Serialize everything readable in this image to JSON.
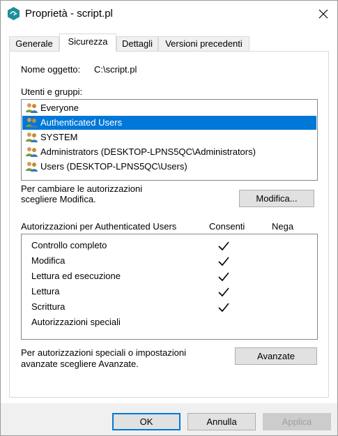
{
  "window": {
    "title": "Proprietà - script.pl"
  },
  "tabs": [
    {
      "label": "Generale"
    },
    {
      "label": "Sicurezza"
    },
    {
      "label": "Dettagli"
    },
    {
      "label": "Versioni precedenti"
    }
  ],
  "active_tab": "Sicurezza",
  "object": {
    "label": "Nome oggetto:",
    "value": "C:\\script.pl"
  },
  "users_label": "Utenti e gruppi:",
  "users": [
    {
      "name": "Everyone",
      "selected": false
    },
    {
      "name": "Authenticated Users",
      "selected": true
    },
    {
      "name": "SYSTEM",
      "selected": false
    },
    {
      "name": "Administrators (DESKTOP-LPNS5QC\\Administrators)",
      "selected": false
    },
    {
      "name": "Users (DESKTOP-LPNS5QC\\Users)",
      "selected": false
    }
  ],
  "change_hint": {
    "line1": "Per cambiare le autorizzazioni",
    "line2": "scegliere Modifica."
  },
  "edit_button": "Modifica...",
  "permissions": {
    "header": "Autorizzazioni per Authenticated Users",
    "allow_col": "Consenti",
    "deny_col": "Nega",
    "items": [
      {
        "name": "Controllo completo",
        "allow": true,
        "deny": false
      },
      {
        "name": "Modifica",
        "allow": true,
        "deny": false
      },
      {
        "name": "Lettura ed esecuzione",
        "allow": true,
        "deny": false
      },
      {
        "name": "Lettura",
        "allow": true,
        "deny": false
      },
      {
        "name": "Scrittura",
        "allow": true,
        "deny": false
      },
      {
        "name": "Autorizzazioni speciali",
        "allow": false,
        "deny": false
      }
    ]
  },
  "advanced_hint": {
    "line1": "Per autorizzazioni speciali o impostazioni",
    "line2": "avanzate scegliere Avanzate."
  },
  "advanced_button": "Avanzate",
  "footer": {
    "ok": "OK",
    "cancel": "Annulla",
    "apply": "Applica"
  },
  "colors": {
    "selection": "#0078d7",
    "dialog_bg": "#f0f0f0",
    "app_icon": "#1f8f9c"
  },
  "icons": {
    "app": "script-file-icon",
    "close": "close-icon",
    "user": "users-group-icon",
    "check": "checkmark-icon"
  }
}
